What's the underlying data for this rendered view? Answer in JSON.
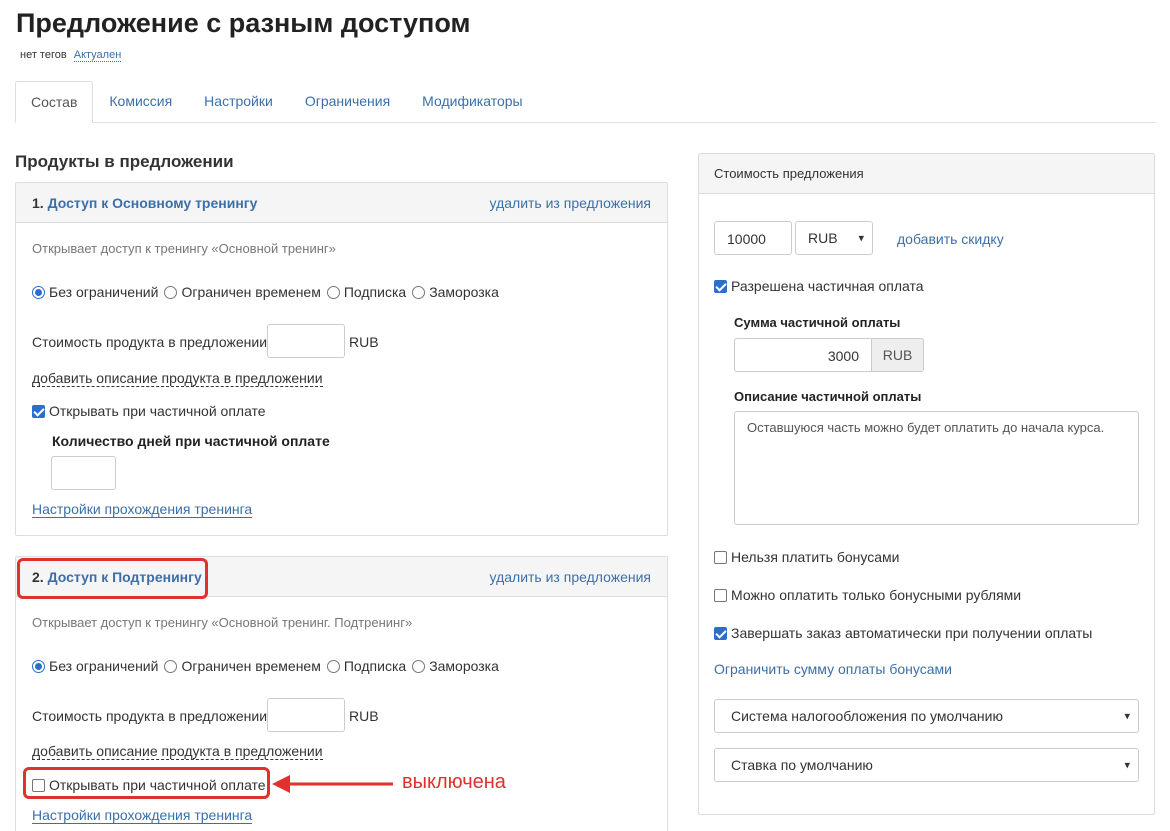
{
  "page": {
    "title": "Предложение с разным доступом",
    "tags": "нет тегов",
    "status": "Актуален"
  },
  "tabs": [
    "Состав",
    "Комиссия",
    "Настройки",
    "Ограничения",
    "Модификаторы"
  ],
  "products_section": {
    "title": "Продукты в предложении",
    "items": [
      {
        "number": "1.",
        "name": "Доступ к Основному тренингу",
        "remove_label": "удалить из предложения",
        "description": "Открывает доступ к тренингу «Основной тренинг»",
        "access_options": [
          "Без ограничений",
          "Ограничен временем",
          "Подписка",
          "Заморозка"
        ],
        "selected_access": "Без ограничений",
        "price_label": "Стоимость продукта в предложении:",
        "price_value": "",
        "currency": "RUB",
        "add_description_label": "добавить описание продукта в предложении",
        "partial_open_label": "Открывать при частичной оплате",
        "partial_open_checked": true,
        "days_label": "Количество дней при частичной оплате",
        "days_value": "",
        "training_settings_label": "Настройки прохождения тренинга"
      },
      {
        "number": "2.",
        "name": "Доступ к Подтренингу",
        "remove_label": "удалить из предложения",
        "description": "Открывает доступ к тренингу «Основной тренинг. Подтренинг»",
        "access_options": [
          "Без ограничений",
          "Ограничен временем",
          "Подписка",
          "Заморозка"
        ],
        "selected_access": "Без ограничений",
        "price_label": "Стоимость продукта в предложении:",
        "price_value": "",
        "currency": "RUB",
        "add_description_label": "добавить описание продукта в предложении",
        "partial_open_label": "Открывать при частичной оплате",
        "partial_open_checked": false,
        "training_settings_label": "Настройки прохождения тренинга"
      }
    ]
  },
  "annotation": {
    "text": "выключена",
    "color": "#e0312d"
  },
  "offer_price": {
    "title": "Стоимость предложения",
    "price_value": "10000",
    "currency_selected": "RUB",
    "add_discount_label": "добавить скидку",
    "partial_payment_label": "Разрешена частичная оплата",
    "partial_payment_checked": true,
    "partial_sum_label": "Сумма частичной оплаты",
    "partial_sum_value": "3000",
    "partial_sum_currency": "RUB",
    "partial_desc_label": "Описание частичной оплаты",
    "partial_desc_value": "Оставшуюся часть можно будет оплатить до начала курса.",
    "no_bonus_label": "Нельзя платить бонусами",
    "no_bonus_checked": false,
    "only_bonus_label": "Можно оплатить только бонусными рублями",
    "only_bonus_checked": false,
    "auto_complete_label": "Завершать заказ автоматически при получении оплаты",
    "auto_complete_checked": true,
    "limit_bonus_label": "Ограничить сумму оплаты бонусами",
    "tax_system_selected": "Система налогообложения по умолчанию",
    "rate_selected": "Ставка по умолчанию"
  },
  "colors": {
    "accent": "#3c6fa8",
    "checkbox": "#2a6fce",
    "highlight": "#e0312d"
  }
}
